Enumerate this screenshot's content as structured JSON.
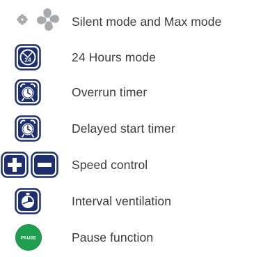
{
  "legend": {
    "items": [
      {
        "icon": "fan-icon",
        "label": "Silent mode and Max mode"
      },
      {
        "icon": "clock-24-icon",
        "label": "24 Hours mode",
        "icon_text": "24"
      },
      {
        "icon": "alarm-clock-icon",
        "label": "Overrun timer"
      },
      {
        "icon": "alarm-clock-icon",
        "label": "Delayed start timer"
      },
      {
        "icon": "plus-minus-icon",
        "label": "Speed control"
      },
      {
        "icon": "interval-clock-icon",
        "label": "Interval ventilation"
      },
      {
        "icon": "pause-button-icon",
        "label": "Pause function",
        "icon_text": "PAUSE"
      }
    ]
  },
  "colors": {
    "navy": "#1d2f6f",
    "grey_fan": "#a7a9ac",
    "green": "#1e9e4f",
    "text": "#3a3a3a"
  }
}
